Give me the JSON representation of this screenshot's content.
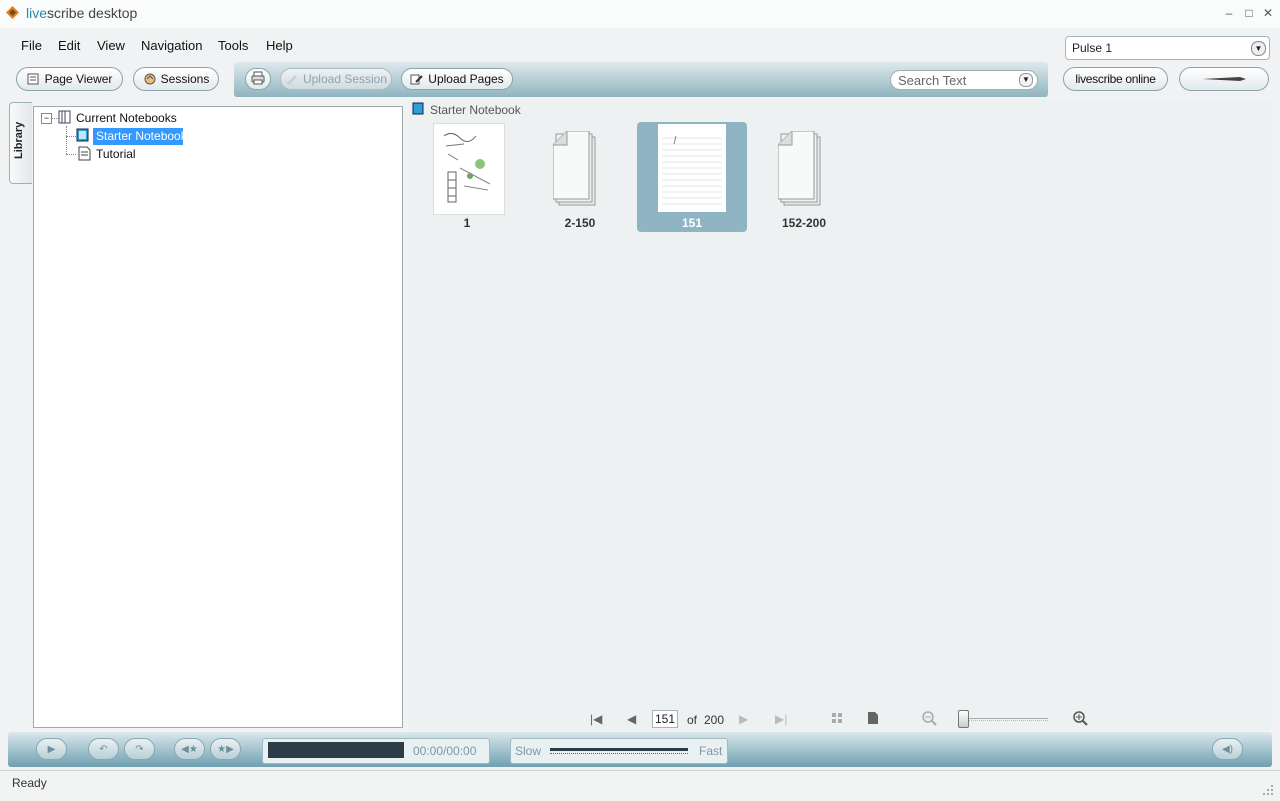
{
  "window": {
    "title_prefix": "live",
    "title_rest": "scribe desktop",
    "minimize": "–",
    "maximize": "□",
    "close": "✕"
  },
  "menu": [
    "File",
    "Edit",
    "View",
    "Navigation",
    "Tools",
    "Help"
  ],
  "toolbar": {
    "page_viewer": "Page Viewer",
    "sessions": "Sessions",
    "upload_session": "Upload Session",
    "upload_pages": "Upload Pages",
    "search_placeholder": "Search Text",
    "livescribe_online": "livescribe online"
  },
  "pen_select": {
    "value": "Pulse 1"
  },
  "library": {
    "tab_label": "Library",
    "tree": {
      "root": "Current Notebooks",
      "items": [
        "Starter Notebook",
        "Tutorial"
      ],
      "selected": "Starter Notebook",
      "expander": "−"
    }
  },
  "content": {
    "breadcrumb": "Starter Notebook",
    "thumbnails": [
      {
        "label": "1"
      },
      {
        "label": "2-150"
      },
      {
        "label": "151"
      },
      {
        "label": "152-200"
      }
    ],
    "selected_index": 2
  },
  "pager": {
    "current_page": "151",
    "of_label": "of",
    "total_pages": "200",
    "first_icon": "|◀",
    "prev_icon": "◀",
    "next_icon": "▶",
    "last_icon": "▶|"
  },
  "player": {
    "time": "00:00/00:00",
    "slow_label": "Slow",
    "fast_label": "Fast"
  },
  "status": {
    "text": "Ready"
  },
  "colors": {
    "accent": "#3399ff",
    "band": "#8fb4c0",
    "selected_thumb": "#8fb4c3"
  }
}
